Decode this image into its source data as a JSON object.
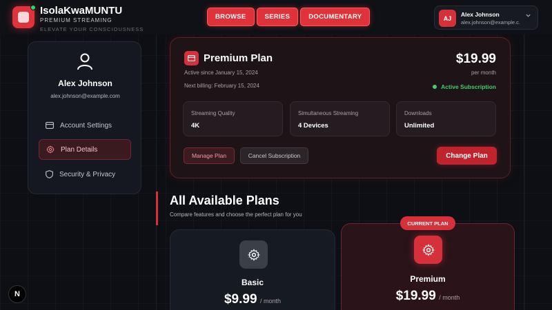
{
  "brand": {
    "name": "IsolaKwaMUNTU",
    "subtitle": "PREMIUM STREAMING",
    "tagline": "ELEVATE YOUR CONSCIOUSNESS"
  },
  "nav": [
    {
      "label": "BROWSE"
    },
    {
      "label": "SERIES"
    },
    {
      "label": "DOCUMENTARY"
    }
  ],
  "user": {
    "initials": "AJ",
    "name": "Alex Johnson",
    "email": "alex.johnson@example.com",
    "email_truncated": "alex.johnson@example.c..."
  },
  "sidebar": {
    "items": [
      {
        "label": "Account Settings",
        "icon": "card-icon"
      },
      {
        "label": "Plan Details",
        "icon": "gear-icon",
        "active": true
      },
      {
        "label": "Security & Privacy",
        "icon": "shield-icon"
      }
    ]
  },
  "current_plan": {
    "title": "Premium Plan",
    "active_since": "Active since January 15, 2024",
    "next_billing": "Next billing: February 15, 2024",
    "price": "$19.99",
    "period": "per month",
    "status": "Active Subscription",
    "features": [
      {
        "label": "Streaming Quality",
        "value": "4K"
      },
      {
        "label": "Simultaneous Streaming",
        "value": "4 Devices"
      },
      {
        "label": "Downloads",
        "value": "Unlimited"
      }
    ],
    "manage_label": "Manage Plan",
    "cancel_label": "Cancel Subscription",
    "change_label": "Change Plan"
  },
  "all_plans": {
    "title": "All Available Plans",
    "subtitle": "Compare features and choose the perfect plan for you",
    "current_badge": "CURRENT PLAN",
    "tiers": [
      {
        "name": "Basic",
        "price": "$9.99",
        "period": "/ month"
      },
      {
        "name": "Premium",
        "price": "$19.99",
        "period": "/ month"
      }
    ]
  },
  "dev_badge": "N",
  "colors": {
    "accent": "#e0323a",
    "success": "#3fcf6e",
    "background": "#0d0f14"
  }
}
